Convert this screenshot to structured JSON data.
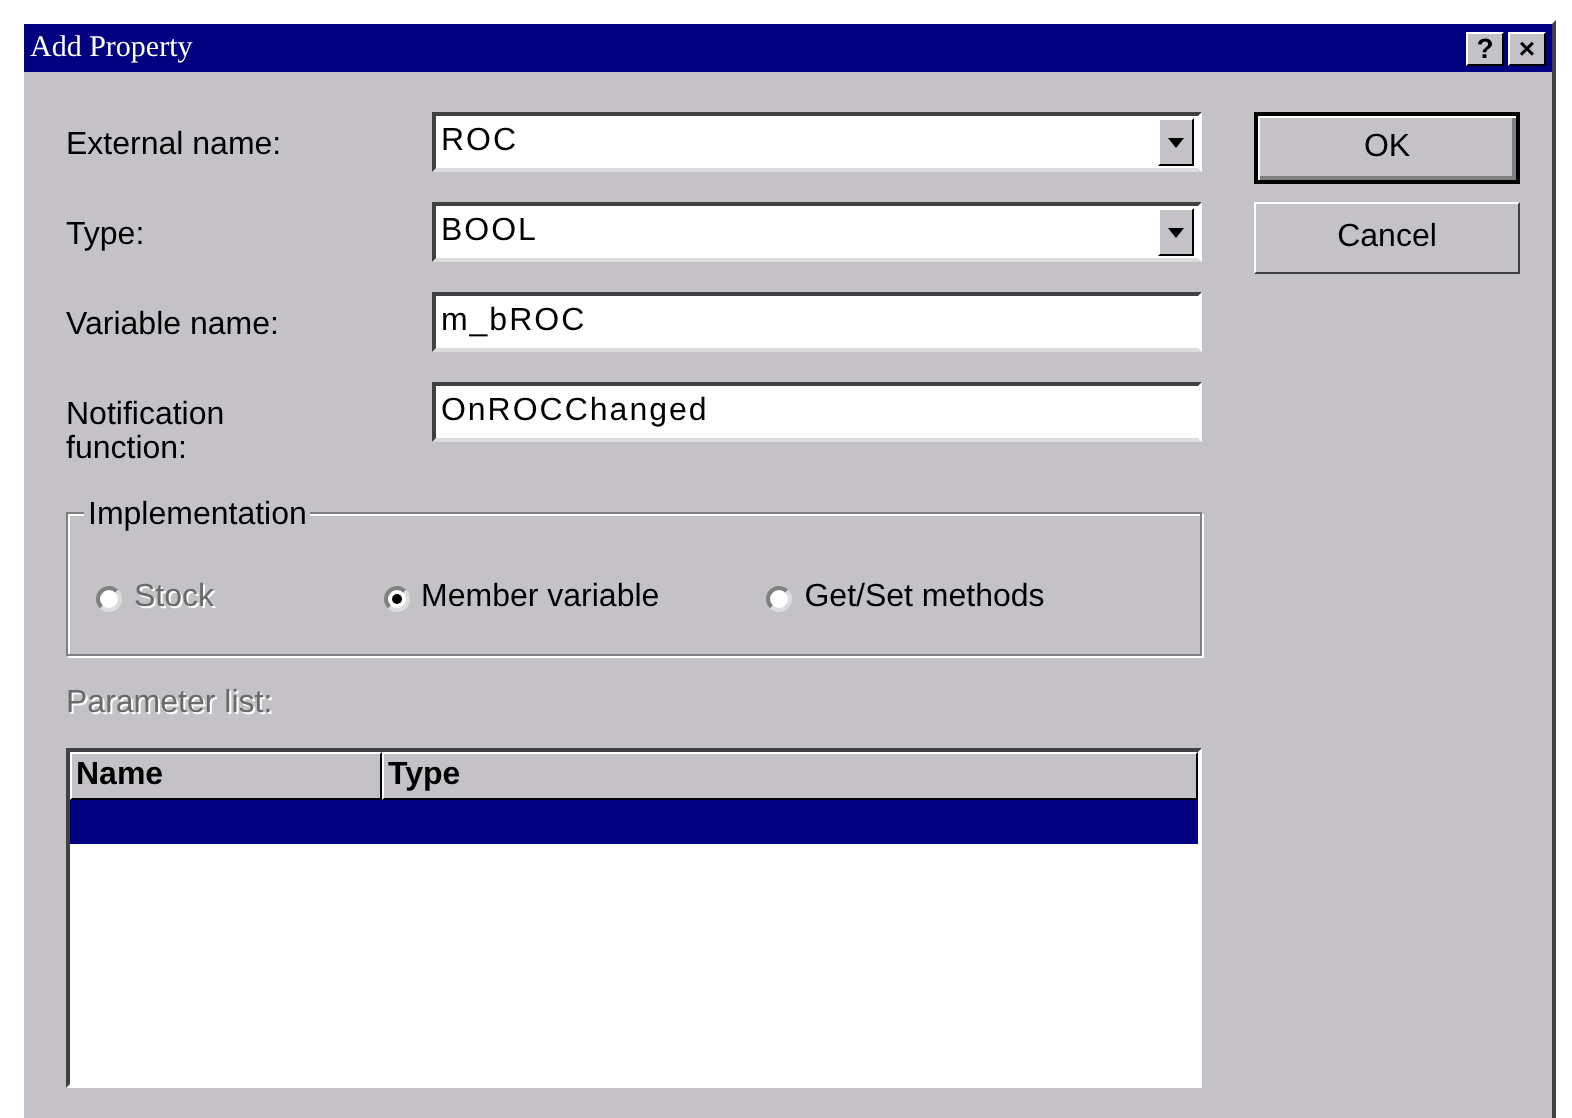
{
  "window": {
    "title": "Add Property",
    "title_buttons": [
      "?",
      "×"
    ]
  },
  "fields": [
    {
      "kind": "combo",
      "label": "External name:",
      "value": "ROC"
    },
    {
      "kind": "combo",
      "label": "Type:",
      "value": "BOOL"
    },
    {
      "kind": "text",
      "label": "Variable name:",
      "value": "m_bROC"
    },
    {
      "kind": "text",
      "label": "Notification function:",
      "value": "OnROCChanged"
    }
  ],
  "buttons": [
    {
      "label": "OK",
      "default": true
    },
    {
      "label": "Cancel",
      "default": false
    }
  ],
  "implementation": {
    "title": "Implementation",
    "options": [
      {
        "label": "Stock",
        "selected": false,
        "disabled": true
      },
      {
        "label": "Member variable",
        "selected": true,
        "disabled": false
      },
      {
        "label": "Get/Set methods",
        "selected": false,
        "disabled": false
      }
    ]
  },
  "parameter_list": {
    "label": "Parameter list:",
    "disabled": true,
    "columns": [
      "Name",
      "Type"
    ],
    "rows": [
      {
        "selected": true
      }
    ]
  }
}
